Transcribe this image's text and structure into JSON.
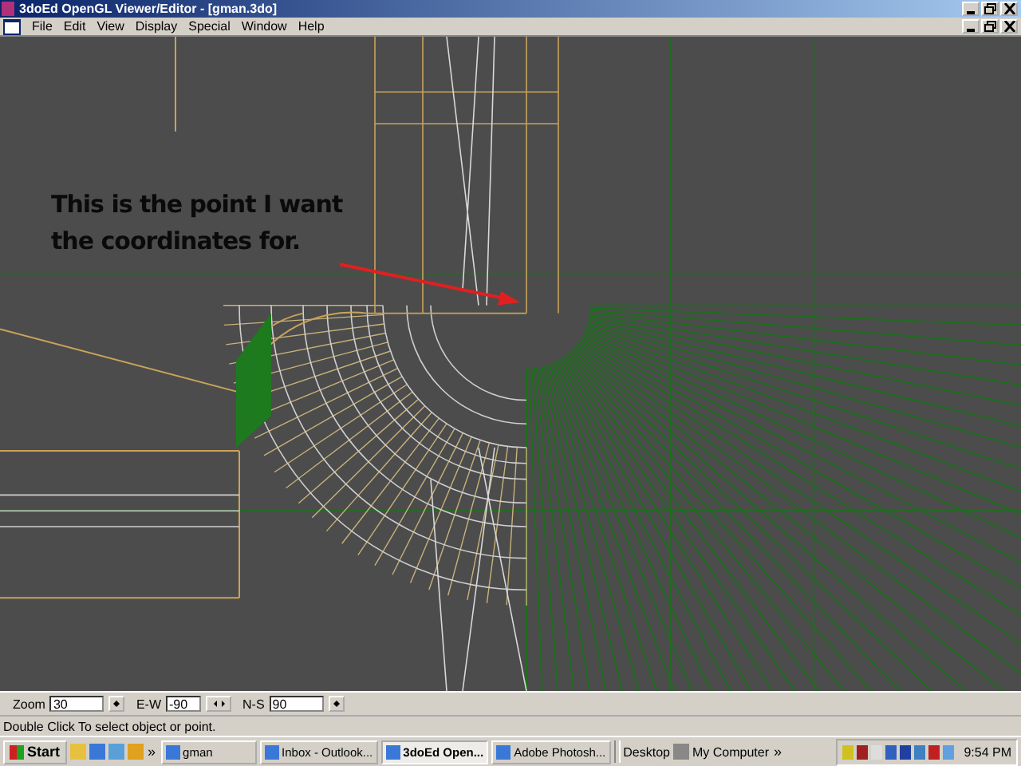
{
  "window": {
    "title": "3doEd OpenGL Viewer/Editor - [gman.3do]"
  },
  "menu": [
    "File",
    "Edit",
    "View",
    "Display",
    "Special",
    "Window",
    "Help"
  ],
  "canvas": {
    "annotation_line_1": "This is the point I want",
    "annotation_line_2": "the coordinates for."
  },
  "toolbar": [
    {
      "label": "Zoom",
      "value": "30",
      "kind": "spin"
    },
    {
      "label": "E-W",
      "value": "-90",
      "kind": "arrows"
    },
    {
      "label": "N-S",
      "value": "90",
      "kind": "spin"
    }
  ],
  "status_bar": "Double Click To select object or point.",
  "taskbar": {
    "start": "Start",
    "chevron": "»",
    "tasks": [
      {
        "label": "gman",
        "selected": false
      },
      {
        "label": "Inbox - Outlook...",
        "selected": false
      },
      {
        "label": "3doEd Open...",
        "selected": true
      },
      {
        "label": "Adobe Photosh...",
        "selected": false
      }
    ],
    "desktop": "Desktop",
    "my_computer": "My Computer",
    "tray_chevron": "»",
    "clock": "9:54 PM"
  }
}
